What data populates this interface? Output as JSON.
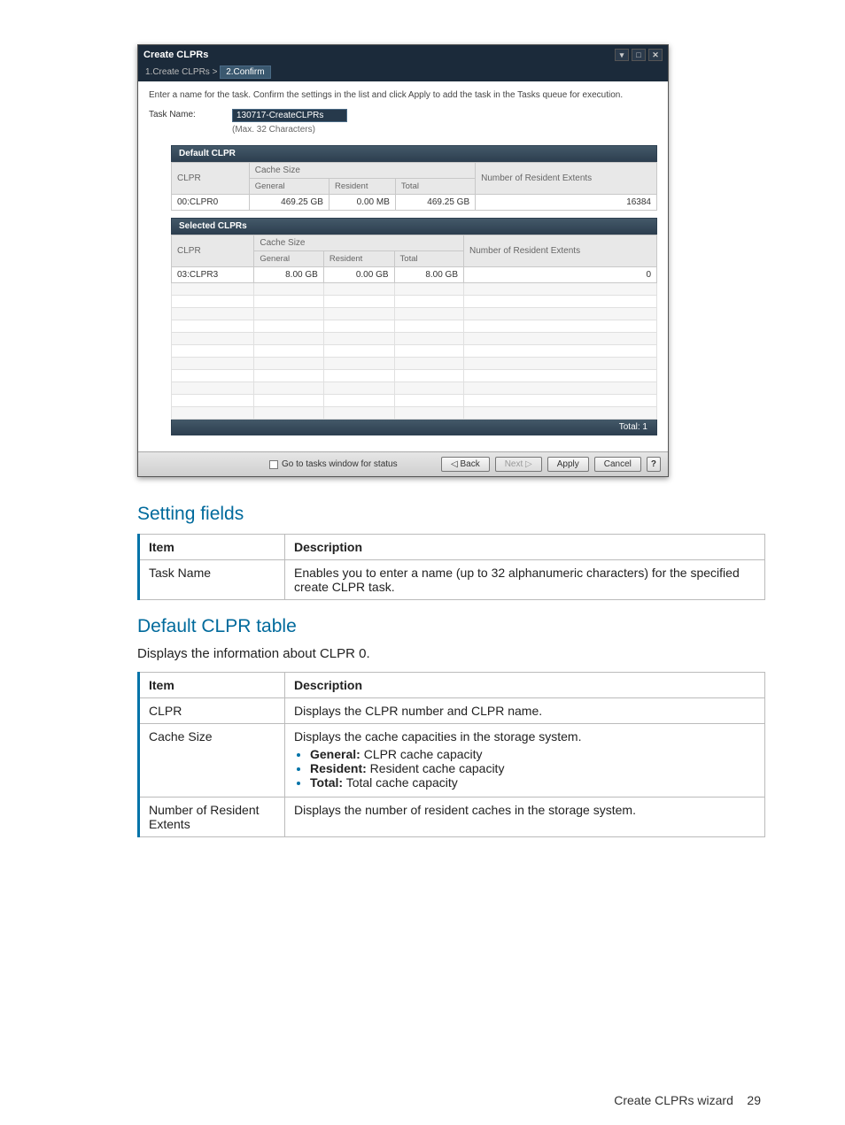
{
  "dialog": {
    "title": "Create CLPRs",
    "breadcrumb": {
      "step1": "1.Create CLPRs",
      "sep": ">",
      "step2": "2.Confirm"
    },
    "instruction": "Enter a name for the task. Confirm the settings in the list and click Apply to add the task in the Tasks queue for execution.",
    "task_label": "Task Name:",
    "task_value": "130717-CreateCLPRs",
    "task_hint": "(Max. 32 Characters)",
    "default_panel": {
      "title": "Default CLPR",
      "cols": {
        "clpr": "CLPR",
        "cache": "Cache Size",
        "general": "General",
        "resident": "Resident",
        "total": "Total",
        "extents": "Number of Resident Extents"
      },
      "row": {
        "clpr": "00:CLPR0",
        "general": "469.25 GB",
        "resident": "0.00 MB",
        "total": "469.25 GB",
        "extents": "16384"
      }
    },
    "selected_panel": {
      "title": "Selected CLPRs",
      "cols": {
        "clpr": "CLPR",
        "cache": "Cache Size",
        "general": "General",
        "resident": "Resident",
        "total": "Total",
        "extents": "Number of Resident Extents"
      },
      "row": {
        "clpr": "03:CLPR3",
        "general": "8.00 GB",
        "resident": "0.00 GB",
        "total": "8.00 GB",
        "extents": "0"
      },
      "total_label": "Total:  1"
    },
    "footer": {
      "checkbox": "Go to tasks window for status",
      "back": "◁ Back",
      "next": "Next ▷",
      "apply": "Apply",
      "cancel": "Cancel",
      "help": "?"
    }
  },
  "sections": {
    "setting_title": "Setting fields",
    "setting_th_item": "Item",
    "setting_th_desc": "Description",
    "setting_row_item": "Task Name",
    "setting_row_desc": "Enables you to enter a name (up to 32 alphanumeric characters) for the specified create CLPR task.",
    "default_title": "Default CLPR table",
    "default_desc": "Displays the information about CLPR 0.",
    "d_th_item": "Item",
    "d_th_desc": "Description",
    "d_r1_item": "CLPR",
    "d_r1_desc": "Displays the CLPR number and CLPR name.",
    "d_r2_item": "Cache Size",
    "d_r2_desc_lead": "Displays the cache capacities in the storage system.",
    "d_r2_b1_k": "General:",
    "d_r2_b1_v": " CLPR cache capacity",
    "d_r2_b2_k": "Resident:",
    "d_r2_b2_v": " Resident cache capacity",
    "d_r2_b3_k": "Total:",
    "d_r2_b3_v": " Total cache capacity",
    "d_r3_item": "Number of Resident Extents",
    "d_r3_desc": "Displays the number of resident caches in the storage system."
  },
  "page_footer": {
    "label": "Create CLPRs wizard",
    "num": "29"
  }
}
